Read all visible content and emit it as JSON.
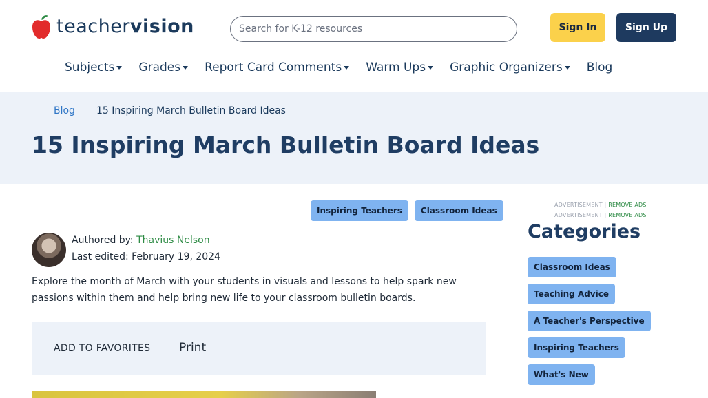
{
  "brand": {
    "name_light": "teacher",
    "name_bold": "vision",
    "apple_color": "#e22b2b",
    "leaf_color": "#2e8b45"
  },
  "search": {
    "placeholder": "Search for K-12 resources",
    "value": ""
  },
  "header": {
    "sign_in": "Sign In",
    "sign_up": "Sign Up",
    "sign_in_color": "#fbd14b",
    "sign_up_color": "#1e3a5f"
  },
  "nav": {
    "items": [
      {
        "label": "Subjects",
        "dropdown": true
      },
      {
        "label": "Grades",
        "dropdown": true
      },
      {
        "label": "Report Card Comments",
        "dropdown": true
      },
      {
        "label": "Warm Ups",
        "dropdown": true
      },
      {
        "label": "Graphic Organizers",
        "dropdown": true
      },
      {
        "label": "Blog",
        "dropdown": false
      }
    ]
  },
  "breadcrumb": {
    "parent": "Blog",
    "current": "15 Inspiring March Bulletin Board Ideas"
  },
  "article": {
    "title": "15 Inspiring March Bulletin Board Ideas",
    "tags": [
      "Inspiring Teachers",
      "Classroom Ideas"
    ],
    "author_prefix": "Authored by:",
    "author_name": "Thavius Nelson",
    "edited": "Last edited: February 19, 2024",
    "intro": "Explore the month of March with your students in visuals and lessons to help spark new passions within them and help bring new life to your classroom bulletin boards.",
    "add_favorites": "ADD TO FAVORITES",
    "print": "Print"
  },
  "sidebar": {
    "ad_label": "ADVERTISEMENT |",
    "remove_ads": "REMOVE ADS",
    "categories_title": "Categories",
    "categories": [
      "Classroom Ideas",
      "Teaching Advice",
      "A Teacher's Perspective",
      "Inspiring Teachers",
      "What's New"
    ]
  },
  "colors": {
    "tag_bg": "#7fb3f0",
    "hero_bg": "#edf2f9",
    "link_blue": "#2f76c6",
    "link_green": "#2e8b45",
    "title_navy": "#1f3d63"
  }
}
